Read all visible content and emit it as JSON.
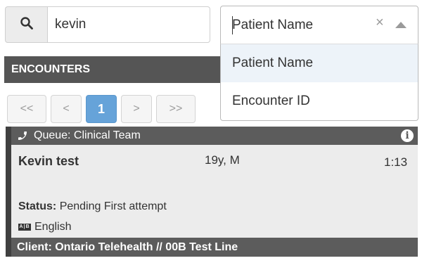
{
  "search": {
    "icon": "search-icon",
    "value": "kevin"
  },
  "search_type": {
    "selected": "Patient Name",
    "clear_symbol": "×",
    "options": [
      "Patient Name",
      "Encounter ID"
    ]
  },
  "encounters": {
    "header": "ENCOUNTERS",
    "pagination": {
      "first": "<<",
      "prev": "<",
      "current_page": "1",
      "next": ">",
      "last": ">>"
    },
    "card": {
      "queue_icon": "phone-icon",
      "queue_label": "Queue: Clinical Team",
      "info_icon": "info-icon",
      "patient_name": "Kevin test",
      "age_sex": "19y, M",
      "elapsed": "1:13",
      "status_label": "Status:",
      "status_value": "Pending First attempt",
      "language_icon": "language-icon",
      "language": "English",
      "client_label": "Client",
      "client_value": ": Ontario Telehealth // 00B Test Line"
    }
  },
  "colors": {
    "header_bg": "#555555",
    "card_bar": "#5c5c5c",
    "card_bg": "#ececec",
    "page_active": "#66a3d9",
    "option_highlight": "#edf3f9"
  }
}
